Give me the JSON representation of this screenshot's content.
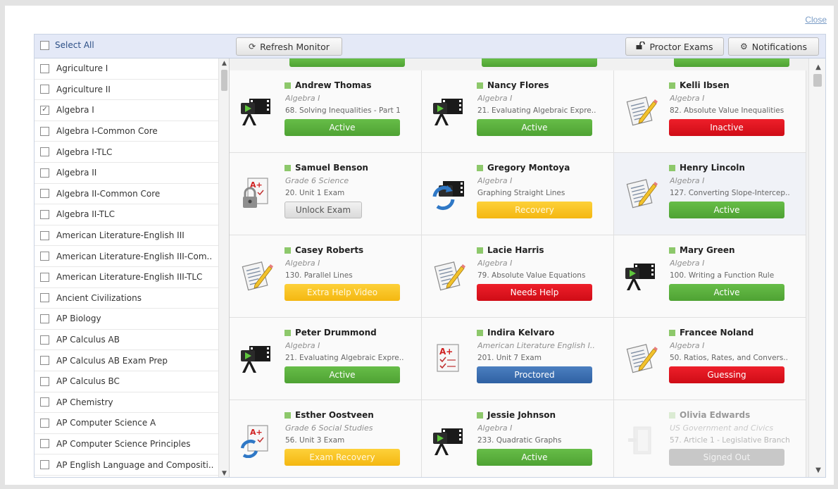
{
  "close_label": "Close",
  "toolbar": {
    "select_all": "Select All",
    "refresh": "Refresh Monitor",
    "proctor": "Proctor Exams",
    "notifications": "Notifications"
  },
  "courses": [
    {
      "label": "Agriculture I",
      "checked": false
    },
    {
      "label": "Agriculture II",
      "checked": false
    },
    {
      "label": "Algebra I",
      "checked": true
    },
    {
      "label": "Algebra I-Common Core",
      "checked": false
    },
    {
      "label": "Algebra I-TLC",
      "checked": false
    },
    {
      "label": "Algebra II",
      "checked": false
    },
    {
      "label": "Algebra II-Common Core",
      "checked": false
    },
    {
      "label": "Algebra II-TLC",
      "checked": false
    },
    {
      "label": "American Literature-English III",
      "checked": false
    },
    {
      "label": "American Literature-English III-Com..",
      "checked": false
    },
    {
      "label": "American Literature-English III-TLC",
      "checked": false
    },
    {
      "label": "Ancient Civilizations",
      "checked": false
    },
    {
      "label": "AP Biology",
      "checked": false
    },
    {
      "label": "AP Calculus AB",
      "checked": false
    },
    {
      "label": "AP Calculus AB Exam Prep",
      "checked": false
    },
    {
      "label": "AP Calculus BC",
      "checked": false
    },
    {
      "label": "AP Chemistry",
      "checked": false
    },
    {
      "label": "AP Computer Science A",
      "checked": false
    },
    {
      "label": "AP Computer Science Principles",
      "checked": false
    },
    {
      "label": "AP English Language and Compositi..",
      "checked": false
    }
  ],
  "students": [
    {
      "name": "Andrew Thomas",
      "course": "Algebra I",
      "lesson": "68. Solving Inequalities - Part 1",
      "status": "Active",
      "style": "active",
      "icon": "video-icon"
    },
    {
      "name": "Nancy Flores",
      "course": "Algebra I",
      "lesson": "21. Evaluating Algebraic Expre..",
      "status": "Active",
      "style": "active",
      "icon": "video-icon"
    },
    {
      "name": "Kelli Ibsen",
      "course": "Algebra I",
      "lesson": "82. Absolute Value Inequalities",
      "status": "Inactive",
      "style": "red",
      "icon": "worksheet-icon"
    },
    {
      "name": "Samuel Benson",
      "course": "Grade 6 Science",
      "lesson": "20. Unit 1 Exam",
      "status": "Unlock Exam",
      "style": "unlock",
      "icon": "locked-exam-icon"
    },
    {
      "name": "Gregory Montoya",
      "course": "Algebra I",
      "lesson": "Graphing Straight Lines",
      "status": "Recovery",
      "style": "yellow",
      "icon": "video-recovery-icon"
    },
    {
      "name": "Henry Lincoln",
      "course": "Algebra I",
      "lesson": "127. Converting Slope-Intercep..",
      "status": "Active",
      "style": "active",
      "icon": "worksheet-icon"
    },
    {
      "name": "Casey Roberts",
      "course": "Algebra I",
      "lesson": "130. Parallel Lines",
      "status": "Extra Help Video",
      "style": "yellow",
      "icon": "worksheet-icon"
    },
    {
      "name": "Lacie Harris",
      "course": "Algebra I",
      "lesson": "79. Absolute Value Equations",
      "status": "Needs Help",
      "style": "red",
      "icon": "worksheet-icon"
    },
    {
      "name": "Mary Green",
      "course": "Algebra I",
      "lesson": "100. Writing a Function Rule",
      "status": "Active",
      "style": "active",
      "icon": "video-icon"
    },
    {
      "name": "Peter  Drummond",
      "course": "Algebra I",
      "lesson": "21. Evaluating Algebraic Expre..",
      "status": "Active",
      "style": "active",
      "icon": "video-icon"
    },
    {
      "name": "Indira Kelvaro",
      "course": "American Literature English I..",
      "lesson": "201. Unit 7 Exam",
      "status": "Proctored",
      "style": "blue",
      "icon": "exam-icon"
    },
    {
      "name": "Francee Noland",
      "course": "Algebra I",
      "lesson": "50. Ratios, Rates, and Convers..",
      "status": "Guessing",
      "style": "red",
      "icon": "worksheet-icon"
    },
    {
      "name": "Esther Oostveen",
      "course": "Grade 6 Social Studies",
      "lesson": "56. Unit 3 Exam",
      "status": "Exam Recovery",
      "style": "yellow",
      "icon": "exam-recovery-icon"
    },
    {
      "name": "Jessie Johnson",
      "course": "Algebra I",
      "lesson": "233. Quadratic Graphs",
      "status": "Active",
      "style": "active",
      "icon": "video-icon"
    },
    {
      "name": "Olivia Edwards",
      "course": "US Government and Civics",
      "lesson": "57. Article 1 - Legislative Branch",
      "status": "Signed Out",
      "style": "gray",
      "icon": "signed-out-icon"
    }
  ]
}
